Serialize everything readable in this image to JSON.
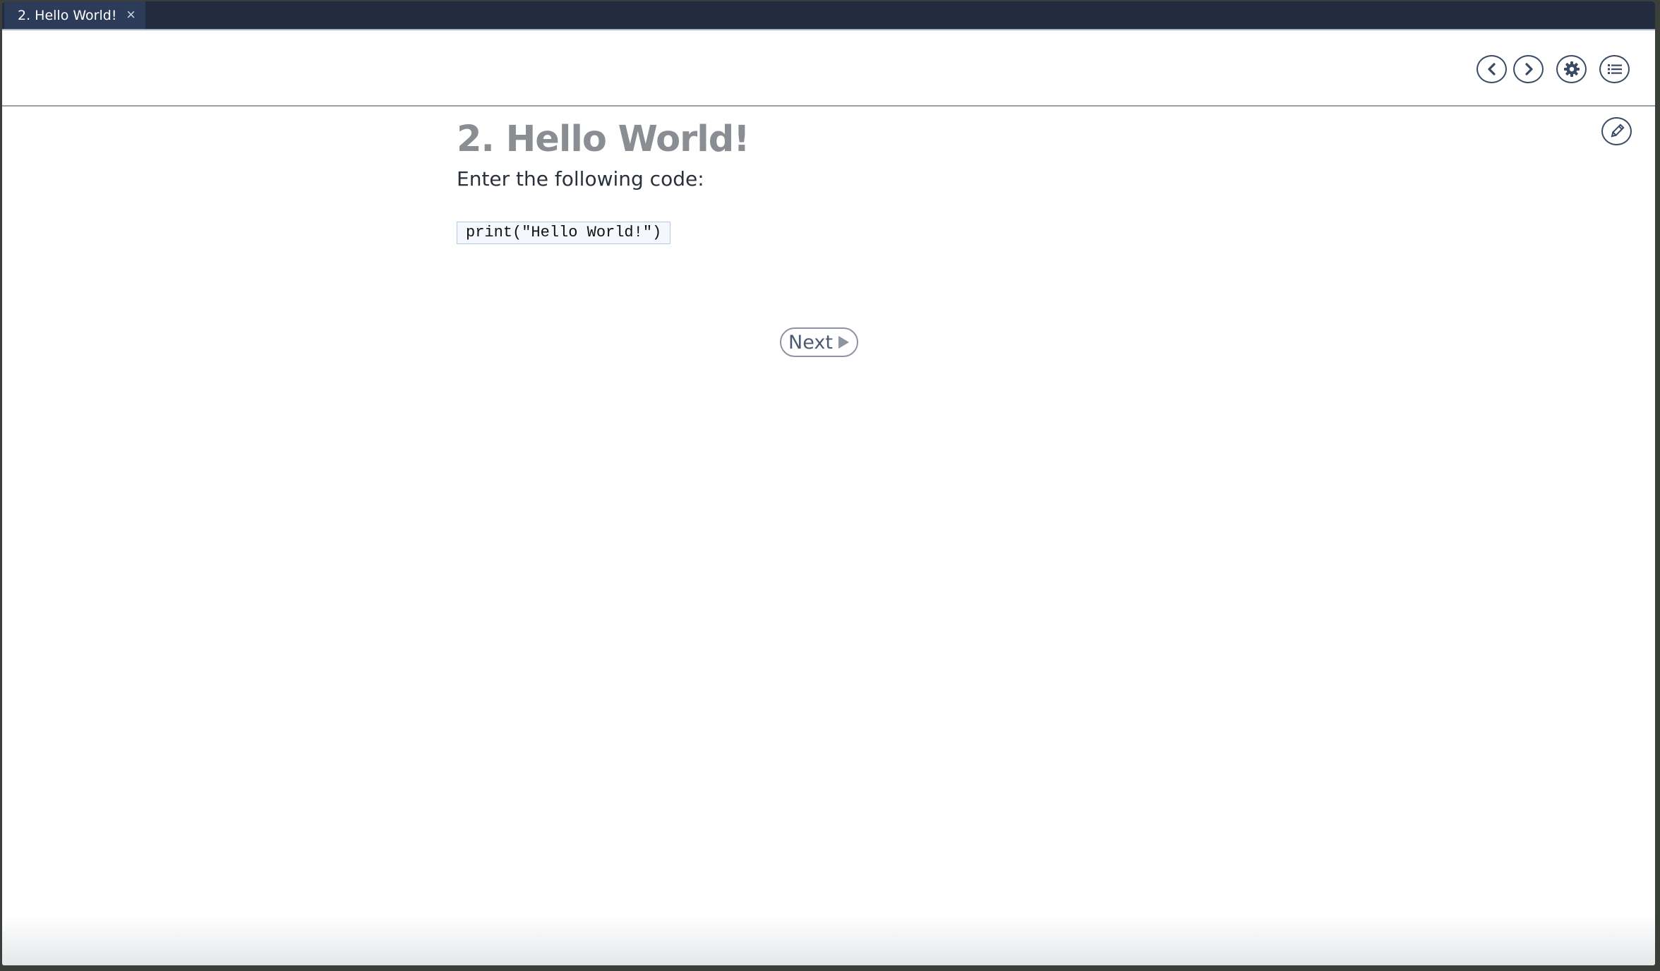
{
  "tabbar": {
    "tab_title": "2. Hello World!",
    "close_glyph": "×"
  },
  "toolbar": {
    "buttons": [
      {
        "name": "previous-button",
        "icon": "chevron-left-icon"
      },
      {
        "name": "next-page-button",
        "icon": "chevron-right-icon"
      },
      {
        "name": "settings-button",
        "icon": "gear-icon"
      },
      {
        "name": "contents-button",
        "icon": "list-icon"
      }
    ],
    "edit_icon": "pencil-icon"
  },
  "main": {
    "title": "2. Hello World!",
    "instructions": "Enter the following code:",
    "code": "print(\"Hello World!\")",
    "next_label": "Next",
    "next_icon": "play-triangle-icon"
  },
  "colors": {
    "tabbar_bg": "#232b3e",
    "active_tab_bg": "#2c3b57",
    "icon_stroke": "#3b4a63",
    "title_gray": "#8a8d91",
    "code_border": "#b7c7e6"
  }
}
